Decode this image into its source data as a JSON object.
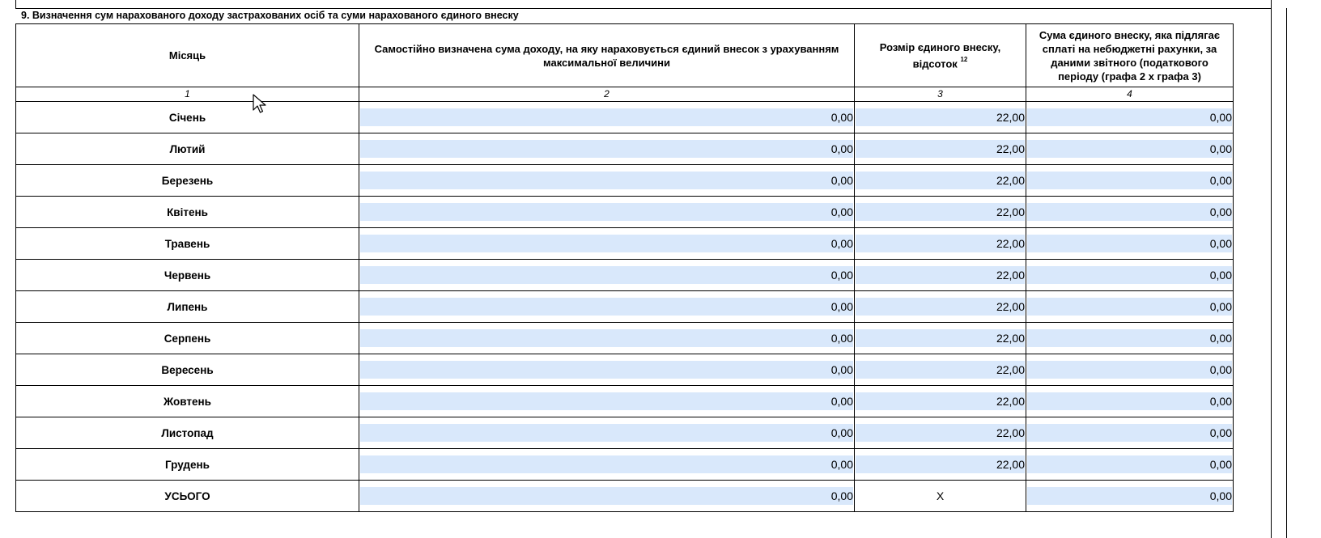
{
  "section": {
    "title": "9. Визначення сум нарахованого доходу застрахованих осіб та суми нарахованого єдиного внеску"
  },
  "columns": [
    {
      "header": "Місяць",
      "number": "1"
    },
    {
      "header": "Самостійно визначена сума доходу, на яку нараховується єдиний внесок з урахуванням максимальної величини",
      "number": "2"
    },
    {
      "header": "Розмір єдиного внеску, відсоток",
      "footnote": "12",
      "number": "3"
    },
    {
      "header": "Сума єдиного внеску, яка підлягає сплаті на небюджетні рахунки, за даними звітного (податкового періоду (графа 2 х графа 3)",
      "number": "4"
    }
  ],
  "rows": [
    {
      "month": "Січень",
      "income": "0,00",
      "rate": "22,00",
      "contribution": "0,00"
    },
    {
      "month": "Лютий",
      "income": "0,00",
      "rate": "22,00",
      "contribution": "0,00"
    },
    {
      "month": "Березень",
      "income": "0,00",
      "rate": "22,00",
      "contribution": "0,00"
    },
    {
      "month": "Квітень",
      "income": "0,00",
      "rate": "22,00",
      "contribution": "0,00"
    },
    {
      "month": "Травень",
      "income": "0,00",
      "rate": "22,00",
      "contribution": "0,00"
    },
    {
      "month": "Червень",
      "income": "0,00",
      "rate": "22,00",
      "contribution": "0,00"
    },
    {
      "month": "Липень",
      "income": "0,00",
      "rate": "22,00",
      "contribution": "0,00"
    },
    {
      "month": "Серпень",
      "income": "0,00",
      "rate": "22,00",
      "contribution": "0,00"
    },
    {
      "month": "Вересень",
      "income": "0,00",
      "rate": "22,00",
      "contribution": "0,00"
    },
    {
      "month": "Жовтень",
      "income": "0,00",
      "rate": "22,00",
      "contribution": "0,00"
    },
    {
      "month": "Листопад",
      "income": "0,00",
      "rate": "22,00",
      "contribution": "0,00"
    },
    {
      "month": "Грудень",
      "income": "0,00",
      "rate": "22,00",
      "contribution": "0,00"
    }
  ],
  "total": {
    "label": "УСЬОГО",
    "income": "0,00",
    "rate": "X",
    "contribution": "0,00"
  },
  "colors": {
    "field_bg": "#d9e8fb",
    "border": "#000000"
  },
  "icons": {
    "cursor": "mouse-pointer-icon"
  }
}
